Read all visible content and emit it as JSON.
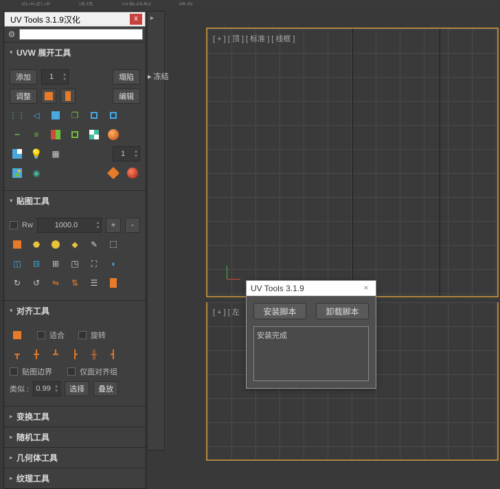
{
  "topmenu": {
    "items": [
      "自由形式",
      "选择",
      "对象绘制",
      "填充"
    ]
  },
  "window": {
    "title": "UV Tools 3.1.9汉化",
    "close": "x"
  },
  "sections": {
    "uvw": {
      "title": "UVW 展开工具",
      "add": "添加",
      "add_count": "1",
      "collapse": "塌陷",
      "adjust": "调整",
      "edit": "编辑",
      "spinner2": "1"
    },
    "map": {
      "title": "贴图工具",
      "rw": "Rw",
      "size": "1000.0",
      "plus": "+",
      "minus": "-"
    },
    "align": {
      "title": "对齐工具",
      "fit": "适合",
      "rotate": "旋转",
      "uv_border": "贴图边界",
      "only_group": "仅面对齐组",
      "similar_label": "类似 :",
      "similar_val": "0.99",
      "select": "选择",
      "stack": "叠放"
    },
    "transform": {
      "title": "变换工具"
    },
    "random": {
      "title": "随机工具"
    },
    "geometry": {
      "title": "几何体工具"
    },
    "texture": {
      "title": "纹理工具"
    }
  },
  "sidebar2": {
    "freeze_label": "冻结",
    "arrow": "▸"
  },
  "viewport_top": {
    "labels": "[ + ]  [ 顶 ]  [ 标准 ]  [ 线框 ]"
  },
  "viewport_left": {
    "labels": "[ + ]  [ 左"
  },
  "dialog": {
    "title": "UV Tools 3.1.9",
    "install": "安装脚本",
    "uninstall": "卸载脚本",
    "output": "安装完成"
  }
}
